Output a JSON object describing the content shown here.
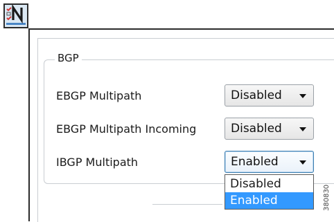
{
  "icons": {
    "app_icon": "checklist-n-icon"
  },
  "group": {
    "title": "BGP"
  },
  "settings": [
    {
      "label": "EBGP Multipath",
      "value": "Disabled"
    },
    {
      "label": "EBGP Multipath Incoming",
      "value": "Disabled"
    },
    {
      "label": "IBGP Multipath",
      "value": "Enabled"
    }
  ],
  "dropdown": {
    "options": [
      "Disabled",
      "Enabled"
    ],
    "selected": "Enabled",
    "highlight_color": "#3399ff"
  },
  "figure_id": "380830"
}
